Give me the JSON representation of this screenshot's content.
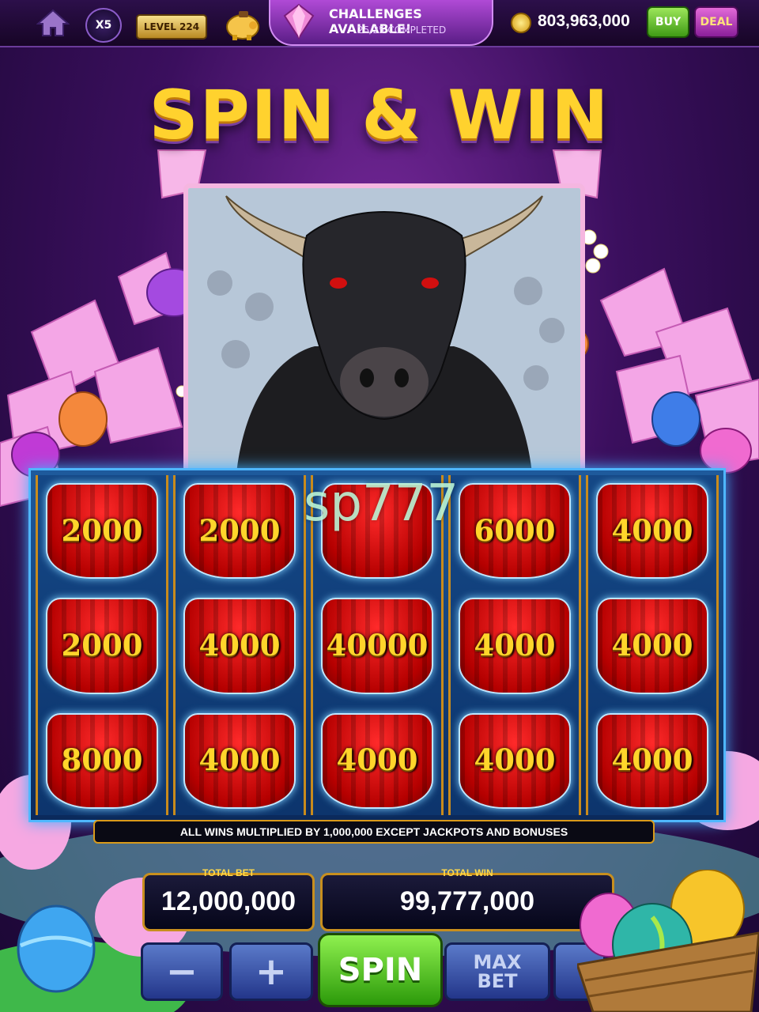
{
  "topbar": {
    "multiplier": "X5",
    "level": "LEVEL 224",
    "challenges": {
      "title": "CHALLENGES AVAILABLE!",
      "progress": "25/25 COMPLETED"
    },
    "balance": "803,963,000",
    "buy_label": "BUY",
    "deal_label": "DEAL"
  },
  "title": "SPIN & WIN",
  "watermark": "sp777",
  "reels": [
    [
      "2000",
      "2000",
      "8000"
    ],
    [
      "2000",
      "4000",
      "4000"
    ],
    [
      "",
      "40000",
      "4000"
    ],
    [
      "6000",
      "4000",
      "4000"
    ],
    [
      "4000",
      "4000",
      "4000"
    ]
  ],
  "banner": "ALL WINS MULTIPLIED BY 1,000,000 EXCEPT JACKPOTS AND BONUSES",
  "total_bet": {
    "label": "TOTAL BET",
    "value": "12,000,000"
  },
  "total_win": {
    "label": "TOTAL WIN",
    "value": "99,777,000"
  },
  "controls": {
    "minus": "−",
    "plus": "+",
    "spin": "SPIN",
    "max_bet_line1": "MAX",
    "max_bet_line2": "BET"
  },
  "colors": {
    "accent_gold": "#ffd22e",
    "cape_red": "#d40000",
    "frame_blue": "#4fb7ff",
    "spin_green": "#3fae14"
  },
  "icons": {
    "home": "home-icon",
    "piggy_bank": "piggy-bank-icon",
    "gem": "gem-icon",
    "coin": "coin-icon"
  }
}
